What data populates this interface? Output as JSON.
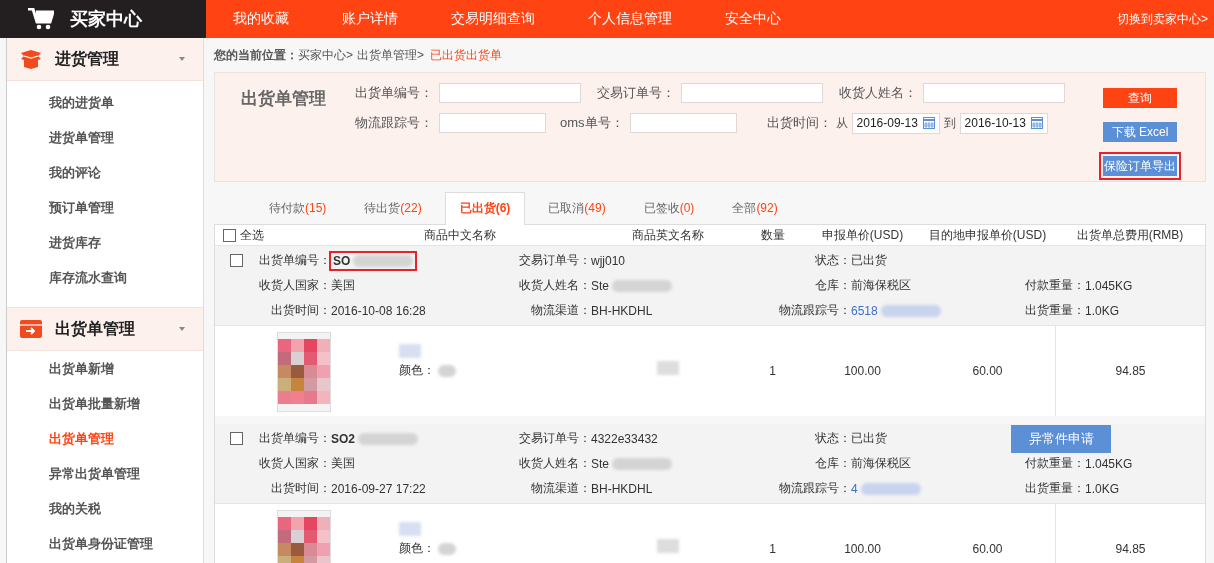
{
  "brand": {
    "title": "买家中心"
  },
  "top_nav": [
    {
      "label": "我的收藏"
    },
    {
      "label": "账户详情"
    },
    {
      "label": "交易明细查询"
    },
    {
      "label": "个人信息管理"
    },
    {
      "label": "安全中心"
    }
  ],
  "switch_link": "切换到卖家中心>",
  "sidebar": [
    {
      "title": "进货管理",
      "expanded": true,
      "children": [
        {
          "label": "我的进货单",
          "selected": false
        },
        {
          "label": "进货单管理",
          "selected": false
        },
        {
          "label": "我的评论",
          "selected": false
        },
        {
          "label": "预订单管理",
          "selected": false
        },
        {
          "label": "进货库存",
          "selected": false
        },
        {
          "label": "库存流水查询",
          "selected": false
        }
      ]
    },
    {
      "title": "出货单管理",
      "expanded": true,
      "children": [
        {
          "label": "出货单新增",
          "selected": false
        },
        {
          "label": "出货单批量新增",
          "selected": false
        },
        {
          "label": "出货单管理",
          "selected": true
        },
        {
          "label": "异常出货单管理",
          "selected": false
        },
        {
          "label": "我的关税",
          "selected": false
        },
        {
          "label": "出货单身份证管理",
          "selected": false
        }
      ]
    }
  ],
  "breadcrumb": {
    "label": "您的当前位置：",
    "path": [
      "买家中心>",
      "出货单管理>"
    ],
    "current": "已出货出货单"
  },
  "filter": {
    "title": "出货单管理",
    "row1": [
      {
        "label": "出货单编号："
      },
      {
        "label": "交易订单号："
      },
      {
        "label": "收货人姓名："
      }
    ],
    "row2": [
      {
        "label": "物流跟踪号："
      },
      {
        "label": "oms单号："
      }
    ],
    "date": {
      "label": "出货时间：",
      "from_label": "从",
      "from": "2016-09-13",
      "to_label": "到",
      "to": "2016-10-13"
    },
    "buttons": [
      {
        "label": "查询",
        "kind": "primary"
      },
      {
        "label": "下载 Excel",
        "kind": "secondary"
      },
      {
        "label": "保险订单导出",
        "kind": "secondary",
        "highlighted": true
      }
    ]
  },
  "tabs": [
    {
      "label": "待付款",
      "count": "(15)",
      "selected": false
    },
    {
      "label": "待出货",
      "count": "(22)",
      "selected": false
    },
    {
      "label": "已出货",
      "count": "(6)",
      "selected": true
    },
    {
      "label": "已取消",
      "count": "(49)",
      "selected": false
    },
    {
      "label": "已签收",
      "count": "(0)",
      "selected": false
    },
    {
      "label": "全部",
      "count": "(92)",
      "selected": false
    }
  ],
  "table": {
    "select_all": {
      "label": "全选",
      "checked": false
    },
    "columns": [
      "商品中文名称",
      "商品英文名称",
      "数量",
      "申报单价(USD)",
      "目的地申报单价(USD)",
      "出货单总费用(RMB)"
    ],
    "orders": [
      {
        "checked": false,
        "rows": [
          [
            {
              "label": "出货单编号：",
              "value": "SO",
              "kind": "bold",
              "redacted": true,
              "highlighted": true
            },
            {
              "label": "交易订单号：",
              "value": "wjj010",
              "kind": "text"
            },
            {
              "label": "状态：",
              "value": "已出货",
              "kind": "text"
            }
          ],
          [
            {
              "label": "收货人国家：",
              "value": "美国",
              "kind": "text"
            },
            {
              "label": "收货人姓名：",
              "value": "Ste",
              "kind": "text",
              "redacted": true
            },
            {
              "label": "仓库：",
              "value": "前海保税区",
              "kind": "text"
            },
            {
              "label": "付款重量：",
              "value": "1.045KG",
              "kind": "text"
            }
          ],
          [
            {
              "label": "出货时间：",
              "value": "2016-10-08 16:28",
              "kind": "text"
            },
            {
              "label": "物流渠道：",
              "value": "BH-HKDHL",
              "kind": "text"
            },
            {
              "label": "物流跟踪号：",
              "value": "6518",
              "kind": "link",
              "redacted": true
            },
            {
              "label": "出货重量：",
              "value": "1.0KG",
              "kind": "text"
            }
          ]
        ],
        "item": {
          "color_label": "颜色：",
          "quantity": "1",
          "price": "100.00",
          "dest_price": "60.00",
          "total": "94.85"
        }
      },
      {
        "checked": false,
        "action": {
          "label": "异常件申请"
        },
        "rows": [
          [
            {
              "label": "出货单编号：",
              "value": "SO2",
              "kind": "bold",
              "redacted": true
            },
            {
              "label": "交易订单号：",
              "value": "4322e33432",
              "kind": "text"
            },
            {
              "label": "状态：",
              "value": "已出货",
              "kind": "text"
            }
          ],
          [
            {
              "label": "收货人国家：",
              "value": "美国",
              "kind": "text"
            },
            {
              "label": "收货人姓名：",
              "value": "Ste",
              "kind": "text",
              "redacted": true
            },
            {
              "label": "仓库：",
              "value": "前海保税区",
              "kind": "text"
            },
            {
              "label": "付款重量：",
              "value": "1.045KG",
              "kind": "text"
            }
          ],
          [
            {
              "label": "出货时间：",
              "value": "2016-09-27 17:22",
              "kind": "text"
            },
            {
              "label": "物流渠道：",
              "value": "BH-HKDHL",
              "kind": "text"
            },
            {
              "label": "物流跟踪号：",
              "value": "4",
              "kind": "link",
              "redacted": true
            },
            {
              "label": "出货重量：",
              "value": "1.0KG",
              "kind": "text"
            }
          ]
        ],
        "item": {
          "color_label": "颜色：",
          "quantity": "1",
          "price": "100.00",
          "dest_price": "60.00",
          "total": "94.85"
        }
      }
    ]
  }
}
